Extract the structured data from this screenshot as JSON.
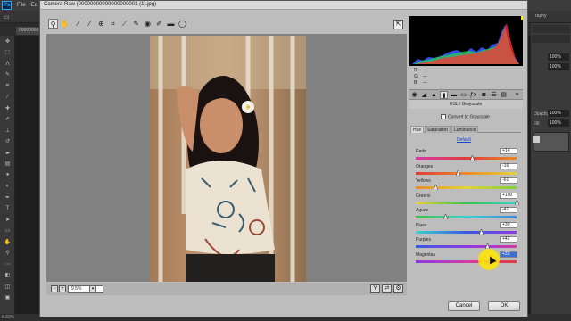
{
  "photoshop": {
    "menus": [
      "File",
      "Ed"
    ],
    "doc_tab": "00000000...",
    "workspace_label": "raphy",
    "right_labels": {
      "opacity": "Opacity:",
      "fill": "Fill:"
    },
    "right_values": {
      "opacity": "100%",
      "fill": "100%",
      "opacity2": "100%",
      "fill2": "100%"
    },
    "status_zoom": "8.33%"
  },
  "camera_raw": {
    "title": "Camera Raw (00000000000000000001 (1).jpg)",
    "histogram": {
      "r_label": "R:",
      "g_label": "G:",
      "b_label": "B:",
      "r_value": "---",
      "g_value": "---",
      "b_value": "---"
    },
    "panel_header": "HSL / Grayscale",
    "convert_label": "Convert to Grayscale",
    "sub_tabs": [
      "Hue",
      "Saturation",
      "Luminance"
    ],
    "active_sub_tab": "Hue",
    "default_label": "Default",
    "sliders": [
      {
        "label": "Reds",
        "value": "+14",
        "level": 0.555
      },
      {
        "label": "Oranges",
        "value": "-16",
        "level": 0.42
      },
      {
        "label": "Yellows",
        "value": "-61",
        "level": 0.195
      },
      {
        "label": "Greens",
        "value": "+100",
        "level": 1.0
      },
      {
        "label": "Aquas",
        "value": "-41",
        "level": 0.295
      },
      {
        "label": "Blues",
        "value": "+30",
        "level": 0.65
      },
      {
        "label": "Purples",
        "value": "+42",
        "level": 0.71
      },
      {
        "label": "Magentas",
        "value": "+33",
        "level": 0.665
      }
    ],
    "zoom_value": "9.5%",
    "buttons": {
      "cancel": "Cancel",
      "ok": "OK"
    }
  }
}
